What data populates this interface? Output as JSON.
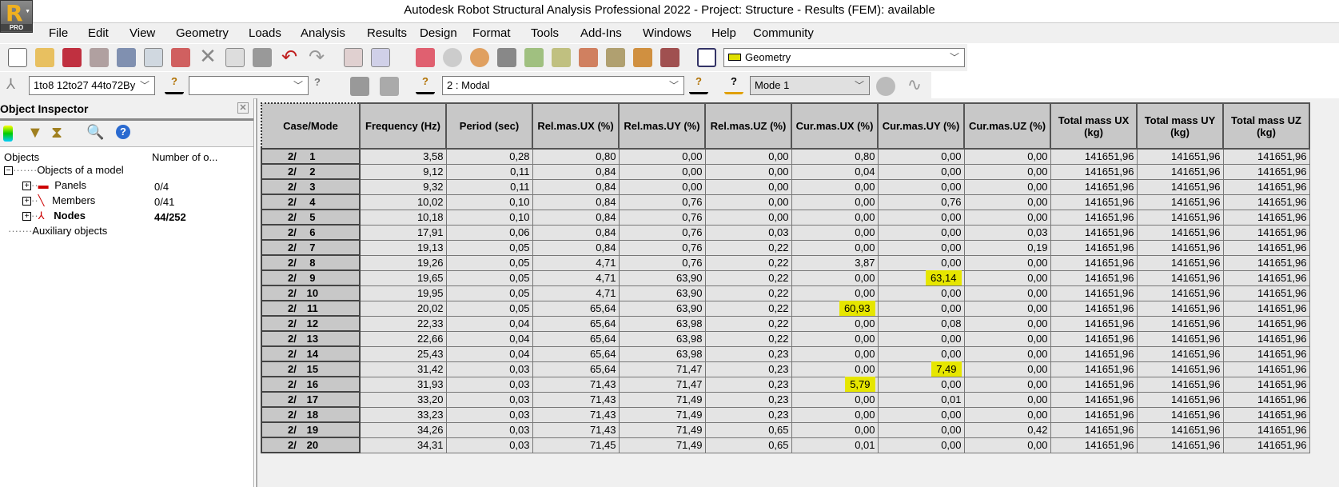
{
  "app": {
    "title": "Autodesk Robot Structural Analysis Professional 2022 - Project: Structure - Results (FEM): available",
    "logo_letter": "R",
    "logo_badge": "PRO"
  },
  "menu": [
    "File",
    "Edit",
    "View",
    "Geometry",
    "Loads",
    "Analysis",
    "Results",
    "Design",
    "Format",
    "Tools",
    "Add-Ins",
    "Windows",
    "Help",
    "Community"
  ],
  "toolbar": {
    "layout_select": "Geometry"
  },
  "selection_bar": {
    "node_selection": "1to8 12to27 44to72By",
    "bar_selection": "",
    "load_case": "2 : Modal",
    "mode": "Mode 1"
  },
  "inspector": {
    "title": "Object Inspector",
    "col_objects": "Objects",
    "col_number": "Number of o...",
    "root": "Objects of a model",
    "items": [
      {
        "label": "Panels",
        "count": "0/4"
      },
      {
        "label": "Members",
        "count": "0/41"
      },
      {
        "label": "Nodes",
        "count": "44/252"
      }
    ],
    "auxiliary": "Auxiliary objects"
  },
  "table": {
    "headers": [
      "Case/Mode",
      "Frequency (Hz)",
      "Period (sec)",
      "Rel.mas.UX (%)",
      "Rel.mas.UY (%)",
      "Rel.mas.UZ (%)",
      "Cur.mas.UX (%)",
      "Cur.mas.UY (%)",
      "Cur.mas.UZ (%)",
      "Total mass UX (kg)",
      "Total mass UY (kg)",
      "Total mass UZ (kg)"
    ],
    "rows": [
      [
        "2/",
        "1",
        "3,58",
        "0,28",
        "0,80",
        "0,00",
        "0,00",
        "0,80",
        "0,00",
        "0,00",
        "141651,96",
        "141651,96",
        "141651,96"
      ],
      [
        "2/",
        "2",
        "9,12",
        "0,11",
        "0,84",
        "0,00",
        "0,00",
        "0,04",
        "0,00",
        "0,00",
        "141651,96",
        "141651,96",
        "141651,96"
      ],
      [
        "2/",
        "3",
        "9,32",
        "0,11",
        "0,84",
        "0,00",
        "0,00",
        "0,00",
        "0,00",
        "0,00",
        "141651,96",
        "141651,96",
        "141651,96"
      ],
      [
        "2/",
        "4",
        "10,02",
        "0,10",
        "0,84",
        "0,76",
        "0,00",
        "0,00",
        "0,76",
        "0,00",
        "141651,96",
        "141651,96",
        "141651,96"
      ],
      [
        "2/",
        "5",
        "10,18",
        "0,10",
        "0,84",
        "0,76",
        "0,00",
        "0,00",
        "0,00",
        "0,00",
        "141651,96",
        "141651,96",
        "141651,96"
      ],
      [
        "2/",
        "6",
        "17,91",
        "0,06",
        "0,84",
        "0,76",
        "0,03",
        "0,00",
        "0,00",
        "0,03",
        "141651,96",
        "141651,96",
        "141651,96"
      ],
      [
        "2/",
        "7",
        "19,13",
        "0,05",
        "0,84",
        "0,76",
        "0,22",
        "0,00",
        "0,00",
        "0,19",
        "141651,96",
        "141651,96",
        "141651,96"
      ],
      [
        "2/",
        "8",
        "19,26",
        "0,05",
        "4,71",
        "0,76",
        "0,22",
        "3,87",
        "0,00",
        "0,00",
        "141651,96",
        "141651,96",
        "141651,96"
      ],
      [
        "2/",
        "9",
        "19,65",
        "0,05",
        "4,71",
        "63,90",
        "0,22",
        "0,00",
        "63,14",
        "0,00",
        "141651,96",
        "141651,96",
        "141651,96"
      ],
      [
        "2/",
        "10",
        "19,95",
        "0,05",
        "4,71",
        "63,90",
        "0,22",
        "0,00",
        "0,00",
        "0,00",
        "141651,96",
        "141651,96",
        "141651,96"
      ],
      [
        "2/",
        "11",
        "20,02",
        "0,05",
        "65,64",
        "63,90",
        "0,22",
        "60,93",
        "0,00",
        "0,00",
        "141651,96",
        "141651,96",
        "141651,96"
      ],
      [
        "2/",
        "12",
        "22,33",
        "0,04",
        "65,64",
        "63,98",
        "0,22",
        "0,00",
        "0,08",
        "0,00",
        "141651,96",
        "141651,96",
        "141651,96"
      ],
      [
        "2/",
        "13",
        "22,66",
        "0,04",
        "65,64",
        "63,98",
        "0,22",
        "0,00",
        "0,00",
        "0,00",
        "141651,96",
        "141651,96",
        "141651,96"
      ],
      [
        "2/",
        "14",
        "25,43",
        "0,04",
        "65,64",
        "63,98",
        "0,23",
        "0,00",
        "0,00",
        "0,00",
        "141651,96",
        "141651,96",
        "141651,96"
      ],
      [
        "2/",
        "15",
        "31,42",
        "0,03",
        "65,64",
        "71,47",
        "0,23",
        "0,00",
        "7,49",
        "0,00",
        "141651,96",
        "141651,96",
        "141651,96"
      ],
      [
        "2/",
        "16",
        "31,93",
        "0,03",
        "71,43",
        "71,47",
        "0,23",
        "5,79",
        "0,00",
        "0,00",
        "141651,96",
        "141651,96",
        "141651,96"
      ],
      [
        "2/",
        "17",
        "33,20",
        "0,03",
        "71,43",
        "71,49",
        "0,23",
        "0,00",
        "0,01",
        "0,00",
        "141651,96",
        "141651,96",
        "141651,96"
      ],
      [
        "2/",
        "18",
        "33,23",
        "0,03",
        "71,43",
        "71,49",
        "0,23",
        "0,00",
        "0,00",
        "0,00",
        "141651,96",
        "141651,96",
        "141651,96"
      ],
      [
        "2/",
        "19",
        "34,26",
        "0,03",
        "71,43",
        "71,49",
        "0,65",
        "0,00",
        "0,00",
        "0,42",
        "141651,96",
        "141651,96",
        "141651,96"
      ],
      [
        "2/",
        "20",
        "34,31",
        "0,03",
        "71,45",
        "71,49",
        "0,65",
        "0,01",
        "0,00",
        "0,00",
        "141651,96",
        "141651,96",
        "141651,96"
      ]
    ],
    "highlights": [
      {
        "row": 9,
        "col": 8
      },
      {
        "row": 11,
        "col": 7
      },
      {
        "row": 15,
        "col": 8
      },
      {
        "row": 16,
        "col": 7
      }
    ],
    "highlight_color": "#e6e600"
  }
}
